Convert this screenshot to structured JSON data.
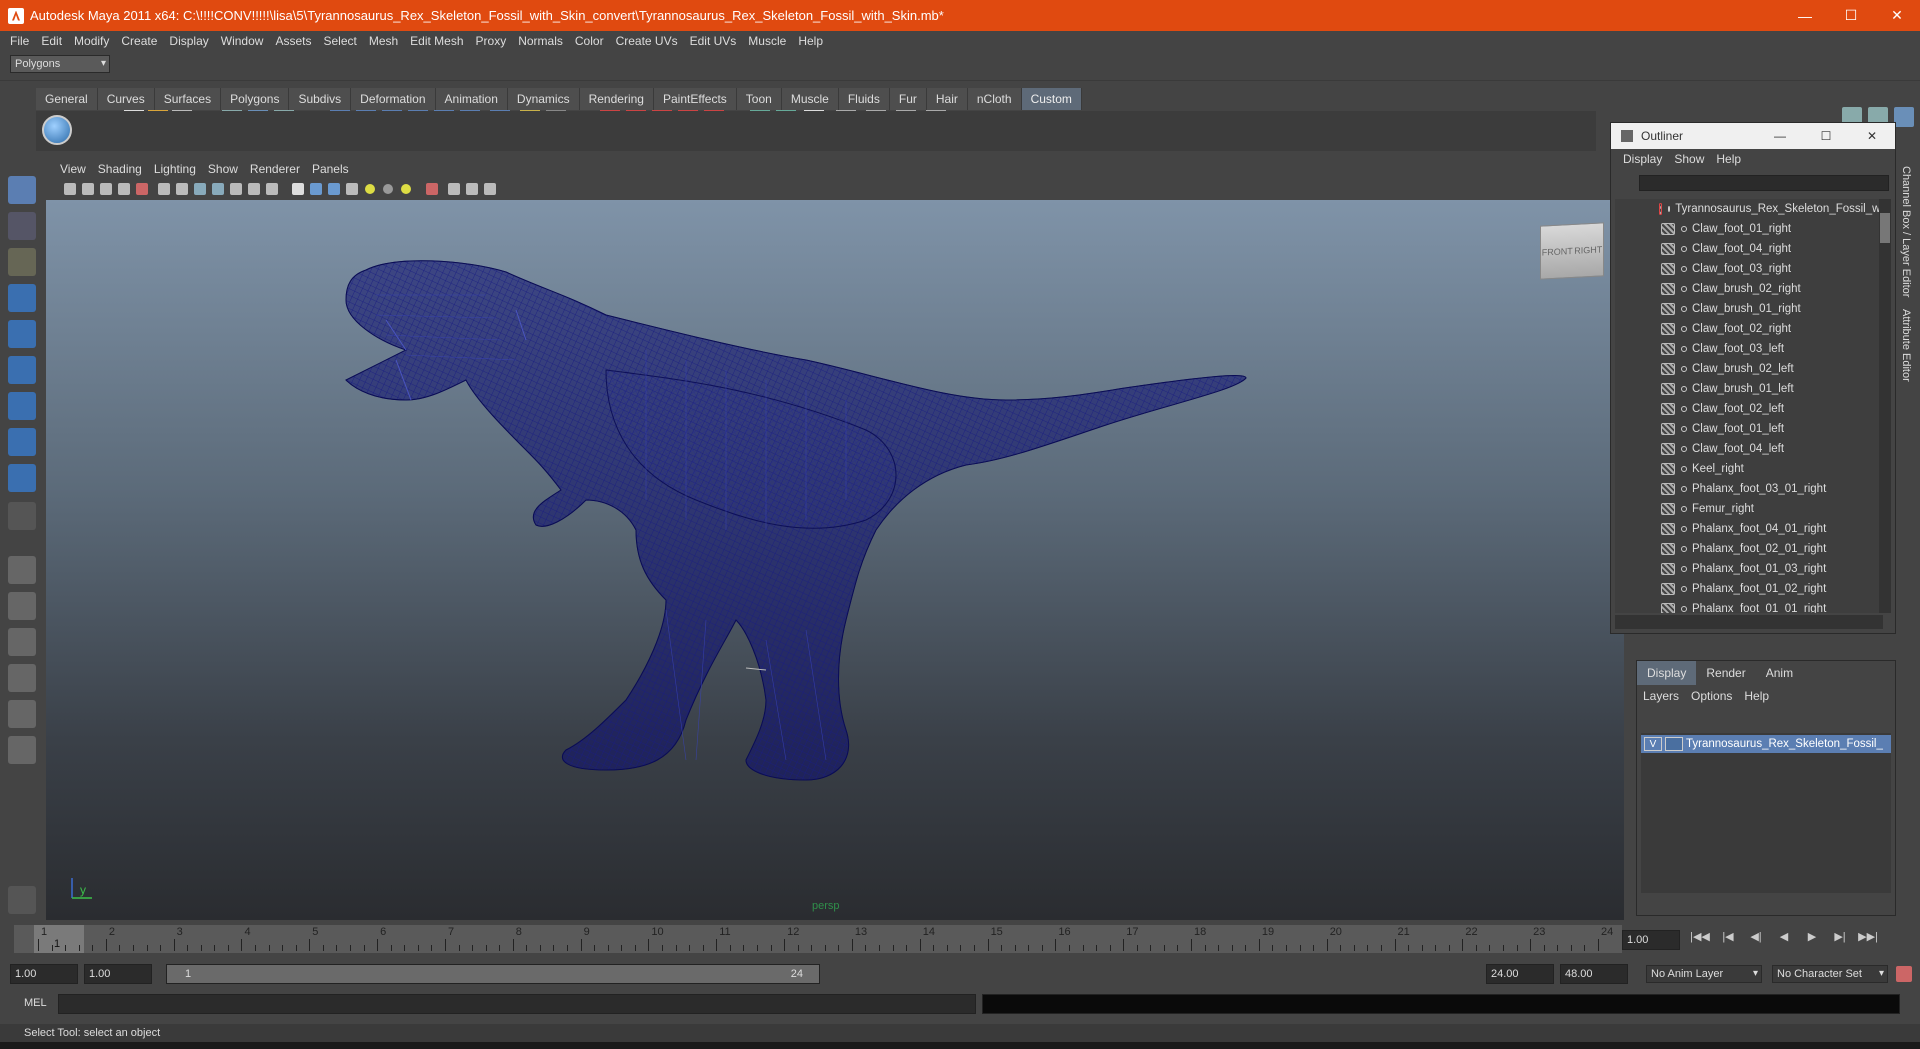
{
  "window": {
    "title": "Autodesk Maya 2011 x64: C:\\!!!!CONV!!!!!\\lisa\\5\\Tyrannosaurus_Rex_Skeleton_Fossil_with_Skin_convert\\Tyrannosaurus_Rex_Skeleton_Fossil_with_Skin.mb*",
    "minimize": "—",
    "maximize": "☐",
    "close": "✕"
  },
  "menubar": [
    "File",
    "Edit",
    "Modify",
    "Create",
    "Display",
    "Window",
    "Assets",
    "Select",
    "Mesh",
    "Edit Mesh",
    "Proxy",
    "Normals",
    "Color",
    "Create UVs",
    "Edit UVs",
    "Muscle",
    "Help"
  ],
  "status": {
    "mode": "Polygons"
  },
  "shelf": {
    "tabs": [
      "General",
      "Curves",
      "Surfaces",
      "Polygons",
      "Subdivs",
      "Deformation",
      "Animation",
      "Dynamics",
      "Rendering",
      "PaintEffects",
      "Toon",
      "Muscle",
      "Fluids",
      "Fur",
      "Hair",
      "nCloth",
      "Custom"
    ],
    "active": "Custom"
  },
  "viewport": {
    "menu": [
      "View",
      "Shading",
      "Lighting",
      "Show",
      "Renderer",
      "Panels"
    ],
    "camera": "persp",
    "viewcube_front": "FRONT",
    "viewcube_right": "RIGHT",
    "axis_label": "y",
    "model_color": "#0d0f6e"
  },
  "outliner": {
    "title": "Outliner",
    "menu": [
      "Display",
      "Show",
      "Help"
    ],
    "items": [
      "Tyrannosaurus_Rex_Skeleton_Fossil_wi",
      "Claw_foot_01_right",
      "Claw_foot_04_right",
      "Claw_foot_03_right",
      "Claw_brush_02_right",
      "Claw_brush_01_right",
      "Claw_foot_02_right",
      "Claw_foot_03_left",
      "Claw_brush_02_left",
      "Claw_brush_01_left",
      "Claw_foot_02_left",
      "Claw_foot_01_left",
      "Claw_foot_04_left",
      "Keel_right",
      "Phalanx_foot_03_01_right",
      "Femur_right",
      "Phalanx_foot_04_01_right",
      "Phalanx_foot_02_01_right",
      "Phalanx_foot_01_03_right",
      "Phalanx_foot_01_02_right",
      "Phalanx_foot_01_01_right"
    ]
  },
  "layers": {
    "tabs": [
      "Display",
      "Render",
      "Anim"
    ],
    "active": "Display",
    "menu": [
      "Layers",
      "Options",
      "Help"
    ],
    "visible_flag": "V",
    "layer_name": "Tyrannosaurus_Rex_Skeleton_Fossil_"
  },
  "sidetabs": [
    "Channel Box / Layer Editor",
    "Attribute Editor"
  ],
  "timeline": {
    "ticks": [
      "1",
      "2",
      "3",
      "4",
      "5",
      "6",
      "7",
      "8",
      "9",
      "10",
      "11",
      "12",
      "13",
      "14",
      "15",
      "16",
      "17",
      "18",
      "19",
      "20",
      "21",
      "22",
      "23",
      "24"
    ],
    "current_frame": "1",
    "current_time_field": "1.00"
  },
  "range": {
    "start": "1.00",
    "playback_start": "1.00",
    "slider_start": "1",
    "slider_end": "24",
    "playback_end": "24.00",
    "end": "48.00",
    "anim_layer": "No Anim Layer",
    "char_set": "No Character Set"
  },
  "playback": [
    "|◀◀",
    "|◀",
    "◀|",
    "◀",
    "▶",
    "▶|",
    "▶▶|"
  ],
  "mel": {
    "label": "MEL"
  },
  "help_line": "Select Tool: select an object"
}
